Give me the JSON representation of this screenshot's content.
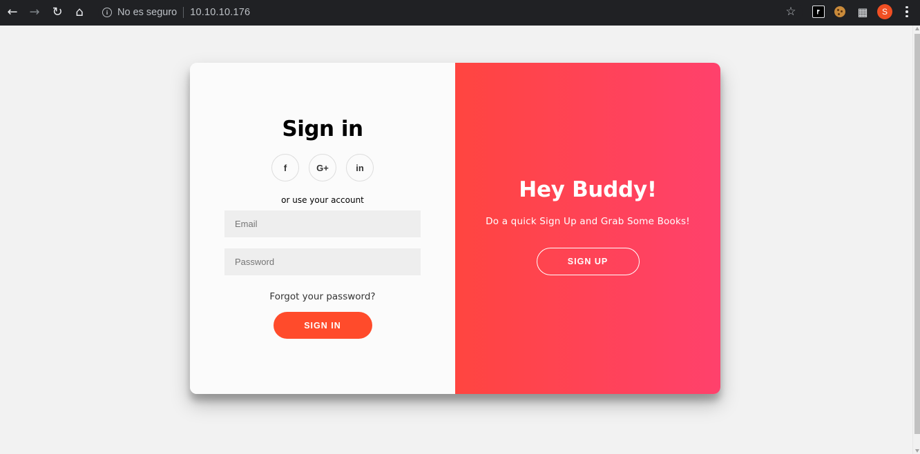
{
  "browser": {
    "security_label": "No es seguro",
    "url": "10.10.10.176",
    "profile_initial": "S",
    "icons": {
      "back": "arrow-left",
      "forward": "arrow-right",
      "reload": "reload",
      "home": "home",
      "info": "info-circle",
      "bookmark": "star-outline",
      "extension_1": "flag-extension",
      "extension_2": "cookie-extension",
      "extensions": "puzzle",
      "menu": "three-dots-vertical"
    }
  },
  "signin": {
    "title": "Sign in",
    "social": [
      {
        "label": "f",
        "icon": "facebook"
      },
      {
        "label": "G+",
        "icon": "google-plus"
      },
      {
        "label": "in",
        "icon": "linkedin"
      }
    ],
    "alt_text": "or use your account",
    "email_placeholder": "Email",
    "password_placeholder": "Password",
    "forgot_label": "Forgot your password?",
    "submit_label": "Sign In"
  },
  "overlay": {
    "title": "Hey Buddy!",
    "text": "Do a quick Sign Up and Grab Some Books!",
    "button_label": "Sign Up"
  },
  "colors": {
    "accent": "#ff4b2b",
    "gradient_start": "#ff4540",
    "gradient_end": "#ff416c",
    "page_bg": "#f2f2f2",
    "chrome_bg": "#202124"
  }
}
